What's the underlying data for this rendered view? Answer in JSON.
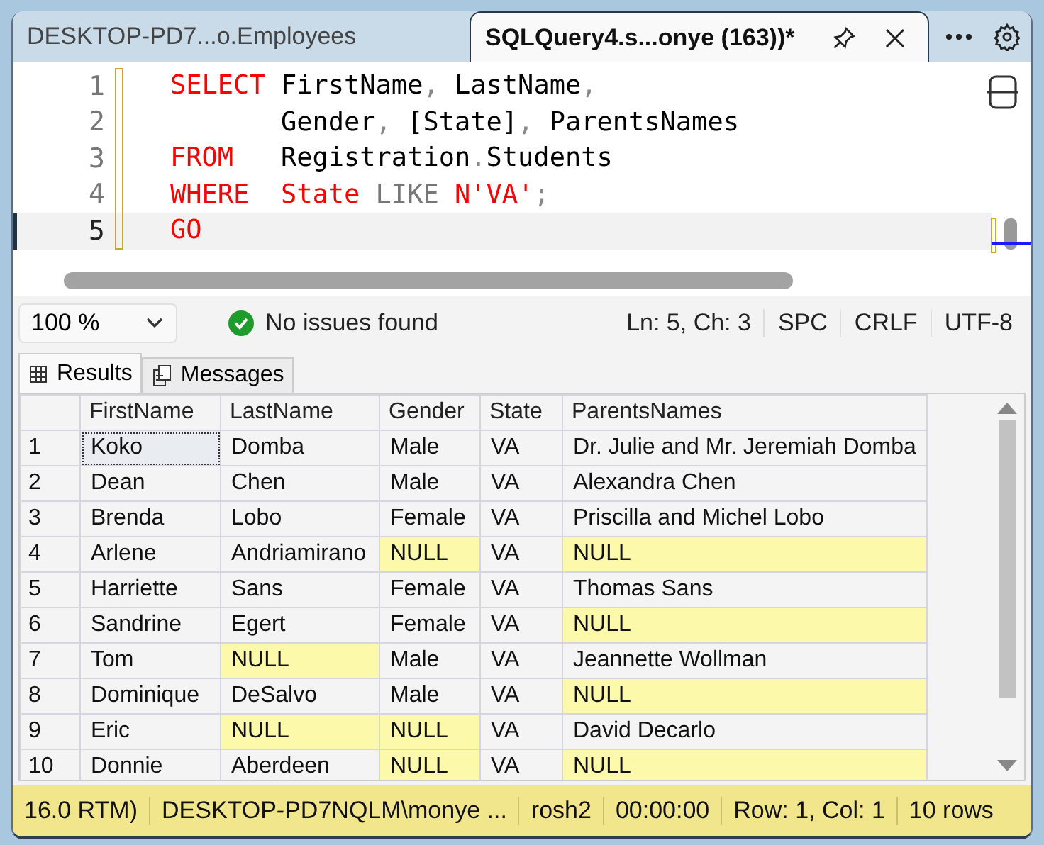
{
  "doc_tabs": [
    {
      "label": "DESKTOP-PD7...o.Employees",
      "selected": false
    },
    {
      "label": "SQLQuery4.s...onye (163))*",
      "selected": true
    }
  ],
  "editor": {
    "lines": [
      {
        "number": "1",
        "current": false,
        "continuation": false,
        "tokens": [
          {
            "kind": "keyword",
            "text": "SELECT "
          },
          {
            "kind": "ident",
            "text": "FirstName"
          },
          {
            "kind": "punct",
            "text": ", "
          },
          {
            "kind": "ident",
            "text": "LastName"
          },
          {
            "kind": "punct",
            "text": ","
          }
        ]
      },
      {
        "number": "2",
        "current": false,
        "continuation": true,
        "tokens": [
          {
            "kind": "ident",
            "text": "Gender"
          },
          {
            "kind": "punct",
            "text": ", "
          },
          {
            "kind": "ident",
            "text": "[State]"
          },
          {
            "kind": "punct",
            "text": ", "
          },
          {
            "kind": "ident",
            "text": "ParentsNames"
          }
        ]
      },
      {
        "number": "3",
        "current": false,
        "continuation": false,
        "tokens": [
          {
            "kind": "keyword",
            "text": "FROM   "
          },
          {
            "kind": "ident",
            "text": "Registration"
          },
          {
            "kind": "punct",
            "text": "."
          },
          {
            "kind": "ident",
            "text": "Students"
          }
        ]
      },
      {
        "number": "4",
        "current": false,
        "continuation": false,
        "tokens": [
          {
            "kind": "keyword",
            "text": "WHERE  State "
          },
          {
            "kind": "operator",
            "text": "LIKE "
          },
          {
            "kind": "keyword",
            "text": "N'VA'"
          },
          {
            "kind": "punct",
            "text": ";"
          }
        ]
      },
      {
        "number": "5",
        "current": true,
        "continuation": false,
        "tokens": [
          {
            "kind": "keyword",
            "text": "GO"
          }
        ]
      }
    ]
  },
  "info_bar": {
    "zoom": "100 %",
    "issues": "No issues found",
    "position": "Ln: 5, Ch: 3",
    "indent": "SPC",
    "line_endings": "CRLF",
    "encoding": "UTF-8"
  },
  "result_tabs": [
    {
      "label": "Results",
      "selected": true
    },
    {
      "label": "Messages",
      "selected": false
    }
  ],
  "table": {
    "columns": [
      "FirstName",
      "LastName",
      "Gender",
      "State",
      "ParentsNames"
    ],
    "rows": [
      {
        "number": "1",
        "cells": [
          {
            "text": "Koko",
            "null": false,
            "selected": true
          },
          {
            "text": "Domba",
            "null": false,
            "selected": false
          },
          {
            "text": "Male",
            "null": false,
            "selected": false
          },
          {
            "text": "VA",
            "null": false,
            "selected": false
          },
          {
            "text": "Dr. Julie and Mr. Jeremiah Domba",
            "null": false,
            "selected": false
          }
        ]
      },
      {
        "number": "2",
        "cells": [
          {
            "text": "Dean",
            "null": false,
            "selected": false
          },
          {
            "text": "Chen",
            "null": false,
            "selected": false
          },
          {
            "text": "Male",
            "null": false,
            "selected": false
          },
          {
            "text": "VA",
            "null": false,
            "selected": false
          },
          {
            "text": "Alexandra Chen",
            "null": false,
            "selected": false
          }
        ]
      },
      {
        "number": "3",
        "cells": [
          {
            "text": "Brenda",
            "null": false,
            "selected": false
          },
          {
            "text": "Lobo",
            "null": false,
            "selected": false
          },
          {
            "text": "Female",
            "null": false,
            "selected": false
          },
          {
            "text": "VA",
            "null": false,
            "selected": false
          },
          {
            "text": "Priscilla and Michel Lobo",
            "null": false,
            "selected": false
          }
        ]
      },
      {
        "number": "4",
        "cells": [
          {
            "text": "Arlene",
            "null": false,
            "selected": false
          },
          {
            "text": "Andriamirano",
            "null": false,
            "selected": false
          },
          {
            "text": "NULL",
            "null": true,
            "selected": false
          },
          {
            "text": "VA",
            "null": false,
            "selected": false
          },
          {
            "text": "NULL",
            "null": true,
            "selected": false
          }
        ]
      },
      {
        "number": "5",
        "cells": [
          {
            "text": "Harriette",
            "null": false,
            "selected": false
          },
          {
            "text": "Sans",
            "null": false,
            "selected": false
          },
          {
            "text": "Female",
            "null": false,
            "selected": false
          },
          {
            "text": "VA",
            "null": false,
            "selected": false
          },
          {
            "text": "Thomas Sans",
            "null": false,
            "selected": false
          }
        ]
      },
      {
        "number": "6",
        "cells": [
          {
            "text": "Sandrine",
            "null": false,
            "selected": false
          },
          {
            "text": "Egert",
            "null": false,
            "selected": false
          },
          {
            "text": "Female",
            "null": false,
            "selected": false
          },
          {
            "text": "VA",
            "null": false,
            "selected": false
          },
          {
            "text": "NULL",
            "null": true,
            "selected": false
          }
        ]
      },
      {
        "number": "7",
        "cells": [
          {
            "text": "Tom",
            "null": false,
            "selected": false
          },
          {
            "text": "NULL",
            "null": true,
            "selected": false
          },
          {
            "text": "Male",
            "null": false,
            "selected": false
          },
          {
            "text": "VA",
            "null": false,
            "selected": false
          },
          {
            "text": "Jeannette Wollman",
            "null": false,
            "selected": false
          }
        ]
      },
      {
        "number": "8",
        "cells": [
          {
            "text": "Dominique",
            "null": false,
            "selected": false
          },
          {
            "text": "DeSalvo",
            "null": false,
            "selected": false
          },
          {
            "text": "Male",
            "null": false,
            "selected": false
          },
          {
            "text": "VA",
            "null": false,
            "selected": false
          },
          {
            "text": "NULL",
            "null": true,
            "selected": false
          }
        ]
      },
      {
        "number": "9",
        "cells": [
          {
            "text": "Eric",
            "null": false,
            "selected": false
          },
          {
            "text": "NULL",
            "null": true,
            "selected": false
          },
          {
            "text": "NULL",
            "null": true,
            "selected": false
          },
          {
            "text": "VA",
            "null": false,
            "selected": false
          },
          {
            "text": "David Decarlo",
            "null": false,
            "selected": false
          }
        ]
      },
      {
        "number": "10",
        "cells": [
          {
            "text": "Donnie",
            "null": false,
            "selected": false
          },
          {
            "text": "Aberdeen",
            "null": false,
            "selected": false
          },
          {
            "text": "NULL",
            "null": true,
            "selected": false
          },
          {
            "text": "VA",
            "null": false,
            "selected": false
          },
          {
            "text": "NULL",
            "null": true,
            "selected": false
          }
        ]
      }
    ]
  },
  "status_bar": [
    "16.0 RTM)",
    "DESKTOP-PD7NQLM\\monye ...",
    "rosh2",
    "00:00:00",
    "Row: 1, Col: 1",
    "10 rows"
  ]
}
